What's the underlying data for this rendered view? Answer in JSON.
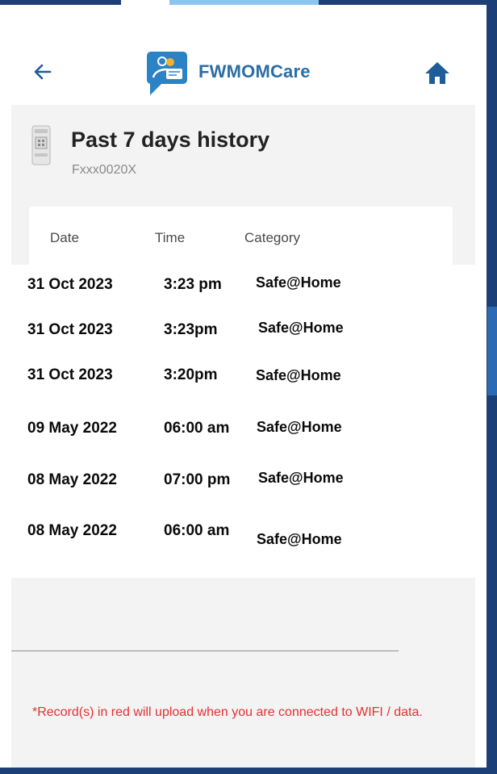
{
  "header": {
    "brand": "FWMOMCare",
    "back_icon": "arrow-left-icon",
    "home_icon": "home-icon",
    "logo_icon": "chat-bubble-people-logo"
  },
  "history": {
    "title": "Past 7 days history",
    "device_id": "Fxxx0020X",
    "device_icon": "qr-device-icon"
  },
  "table": {
    "columns": [
      "Date",
      "Time",
      "Category"
    ],
    "rows": [
      {
        "date": "31 Oct 2023",
        "time": "3:23 pm",
        "category": "Safe@Home"
      },
      {
        "date": "31 Oct 2023",
        "time": "3:23pm",
        "category": "Safe@Home"
      },
      {
        "date": "31 Oct 2023",
        "time": "3:20pm",
        "category": "Safe@Home"
      },
      {
        "date": "09 May 2022",
        "time": "06:00 am",
        "category": "Safe@Home"
      },
      {
        "date": "08 May 2022",
        "time": "07:00 pm",
        "category": "Safe@Home"
      },
      {
        "date": "08 May 2022",
        "time": "06:00 am",
        "category": "Safe@Home"
      }
    ]
  },
  "footer": {
    "note": "*Record(s) in red will upload when you are connected to WIFI / data."
  },
  "colors": {
    "brand": "#2b6da4",
    "note": "#e23232",
    "outer_background": "#1b3f76"
  }
}
